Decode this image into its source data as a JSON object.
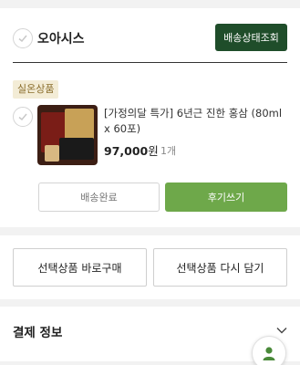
{
  "store": {
    "name": "오아시스",
    "track_button": "배송상태조회"
  },
  "item": {
    "badge": "실온상품",
    "title": "[가정의달 특가] 6년근 진한 홍삼 (80ml x 60포)",
    "price": "97,000",
    "price_unit": "원",
    "quantity": "1개",
    "status_button": "배송완료",
    "review_button": "후기쓰기",
    "image_icon": "red-ginseng-product-thumbnail"
  },
  "actions": {
    "buy_selected": "선택상품 바로구매",
    "cart_selected": "선택상품 다시 담기"
  },
  "payment": {
    "title": "결제 정보"
  },
  "colors": {
    "brand_dark_green": "#1f4d2a",
    "accent_green": "#6ea84a",
    "badge_bg": "#f3ecd6",
    "badge_text": "#8a6d2c"
  },
  "icons": {
    "check": "check-icon",
    "chevron": "chevron-down-icon",
    "profile": "user-icon"
  }
}
